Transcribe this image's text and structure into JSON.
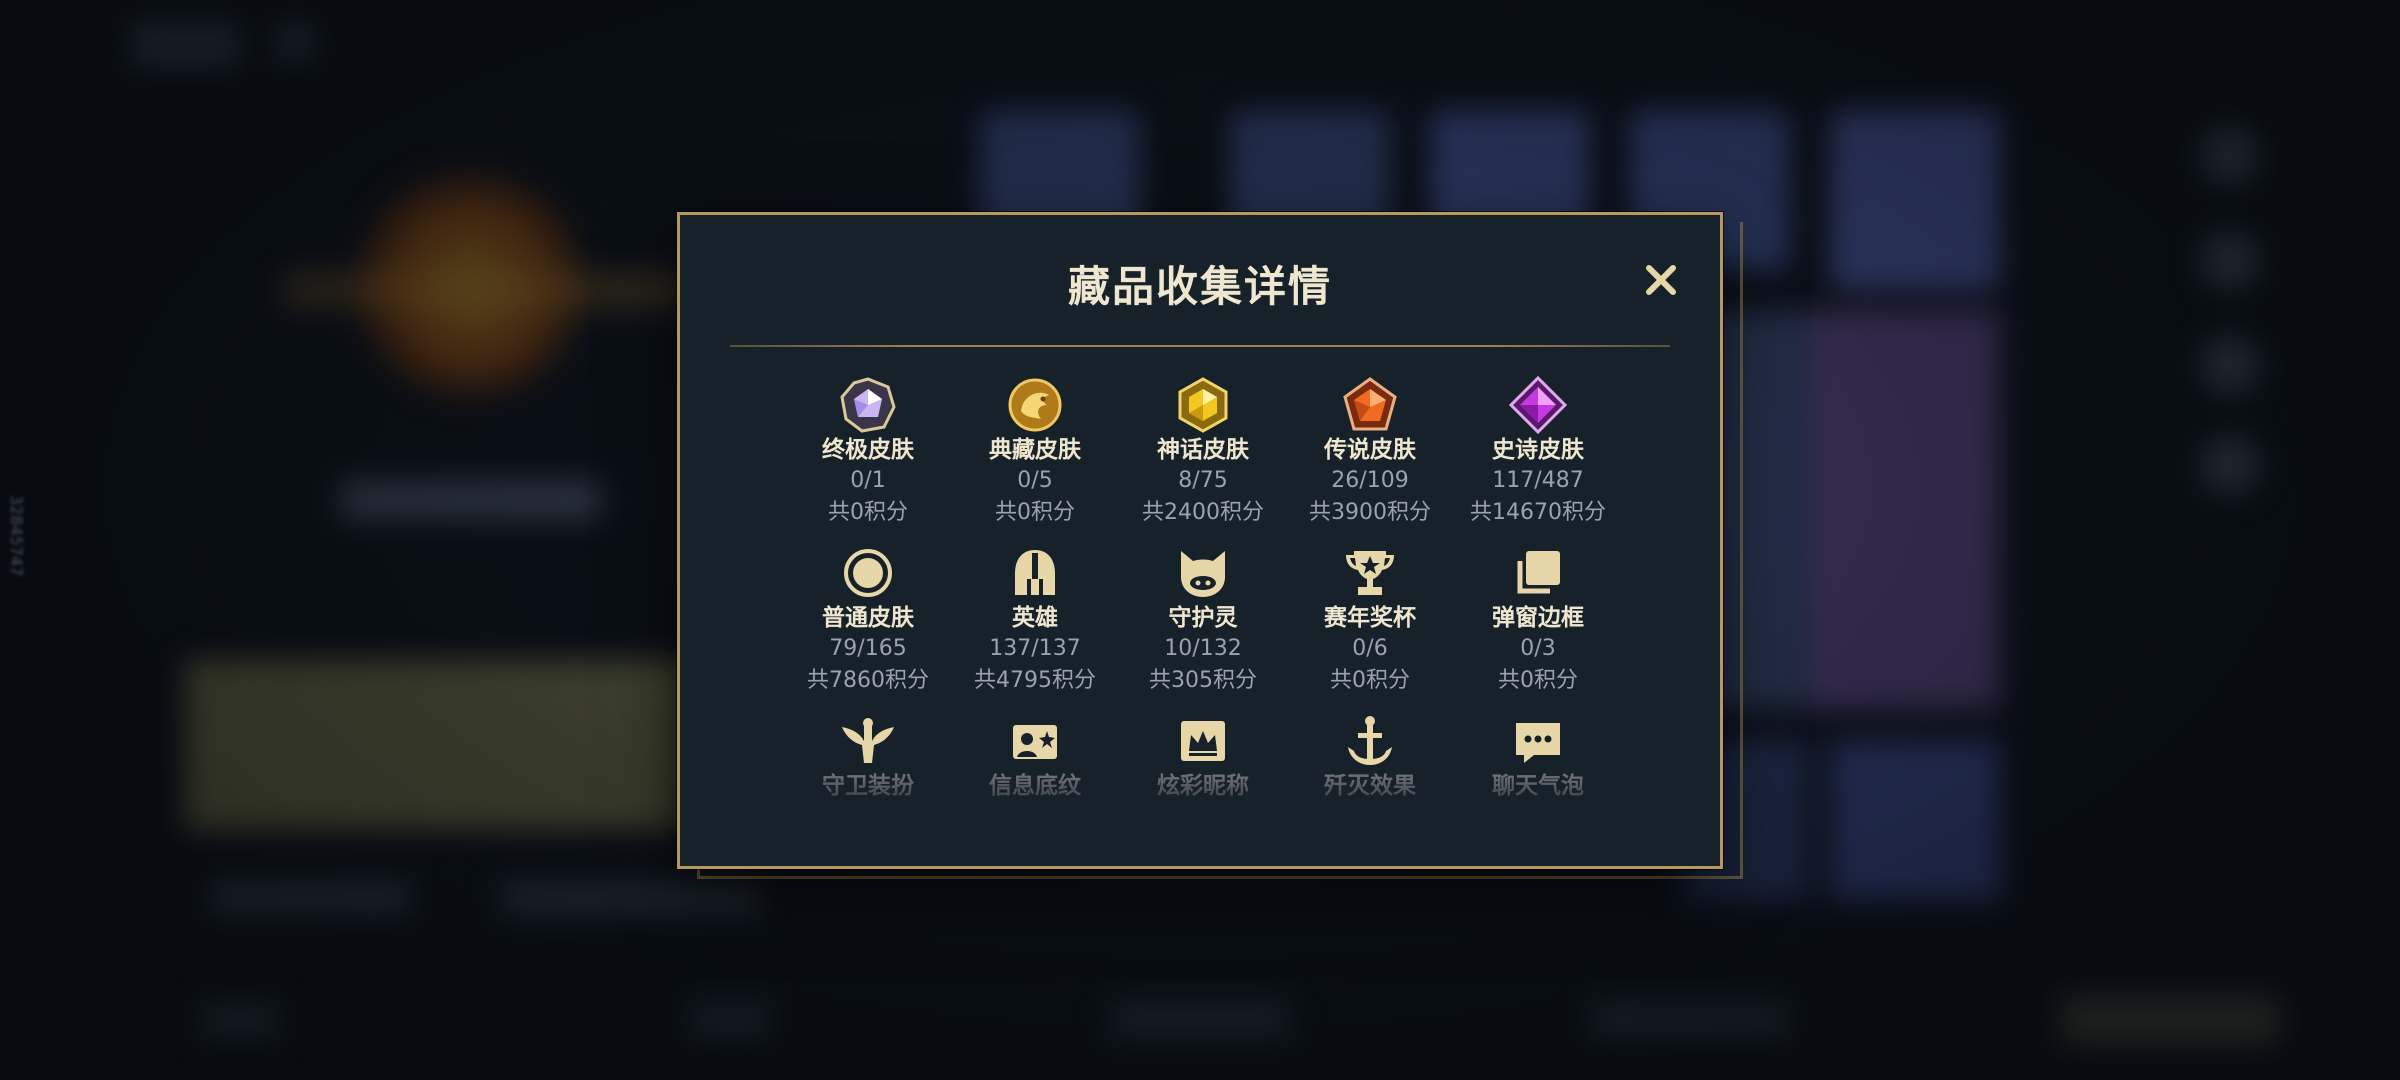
{
  "side_id": "32845747",
  "modal": {
    "title": "藏品收集详情",
    "close_glyph": "✕"
  },
  "collection": [
    {
      "icon": "ultimate-skin-gem-icon",
      "label": "终极皮肤",
      "count": "0/1",
      "points": "共0积分"
    },
    {
      "icon": "treasured-skin-dragon-icon",
      "label": "典藏皮肤",
      "count": "0/5",
      "points": "共0积分"
    },
    {
      "icon": "mythic-skin-gem-icon",
      "label": "神话皮肤",
      "count": "8/75",
      "points": "共2400积分"
    },
    {
      "icon": "legendary-skin-gem-icon",
      "label": "传说皮肤",
      "count": "26/109",
      "points": "共3900积分"
    },
    {
      "icon": "epic-skin-gem-icon",
      "label": "史诗皮肤",
      "count": "117/487",
      "points": "共14670积分"
    },
    {
      "icon": "common-skin-ring-icon",
      "label": "普通皮肤",
      "count": "79/165",
      "points": "共7860积分"
    },
    {
      "icon": "hero-helmet-icon",
      "label": "英雄",
      "count": "137/137",
      "points": "共4795积分"
    },
    {
      "icon": "guardian-spirit-icon",
      "label": "守护灵",
      "count": "10/132",
      "points": "共305积分"
    },
    {
      "icon": "season-trophy-icon",
      "label": "赛年奖杯",
      "count": "0/6",
      "points": "共0积分"
    },
    {
      "icon": "popup-frame-icon",
      "label": "弹窗边框",
      "count": "0/3",
      "points": "共0积分"
    },
    {
      "icon": "guard-outfit-icon",
      "label": "守卫装扮",
      "count": "",
      "points": ""
    },
    {
      "icon": "info-card-icon",
      "label": "信息底纹",
      "count": "",
      "points": ""
    },
    {
      "icon": "flashy-nickname-icon",
      "label": "炫彩昵称",
      "count": "",
      "points": ""
    },
    {
      "icon": "elimination-effect-icon",
      "label": "歼灭效果",
      "count": "",
      "points": ""
    },
    {
      "icon": "chat-bubble-icon",
      "label": "聊天气泡",
      "count": "",
      "points": ""
    }
  ],
  "colors": {
    "gold": "#b59a5c",
    "panel": "#17212a",
    "label": "#efe6cf",
    "muted": "#9aa2ab"
  }
}
